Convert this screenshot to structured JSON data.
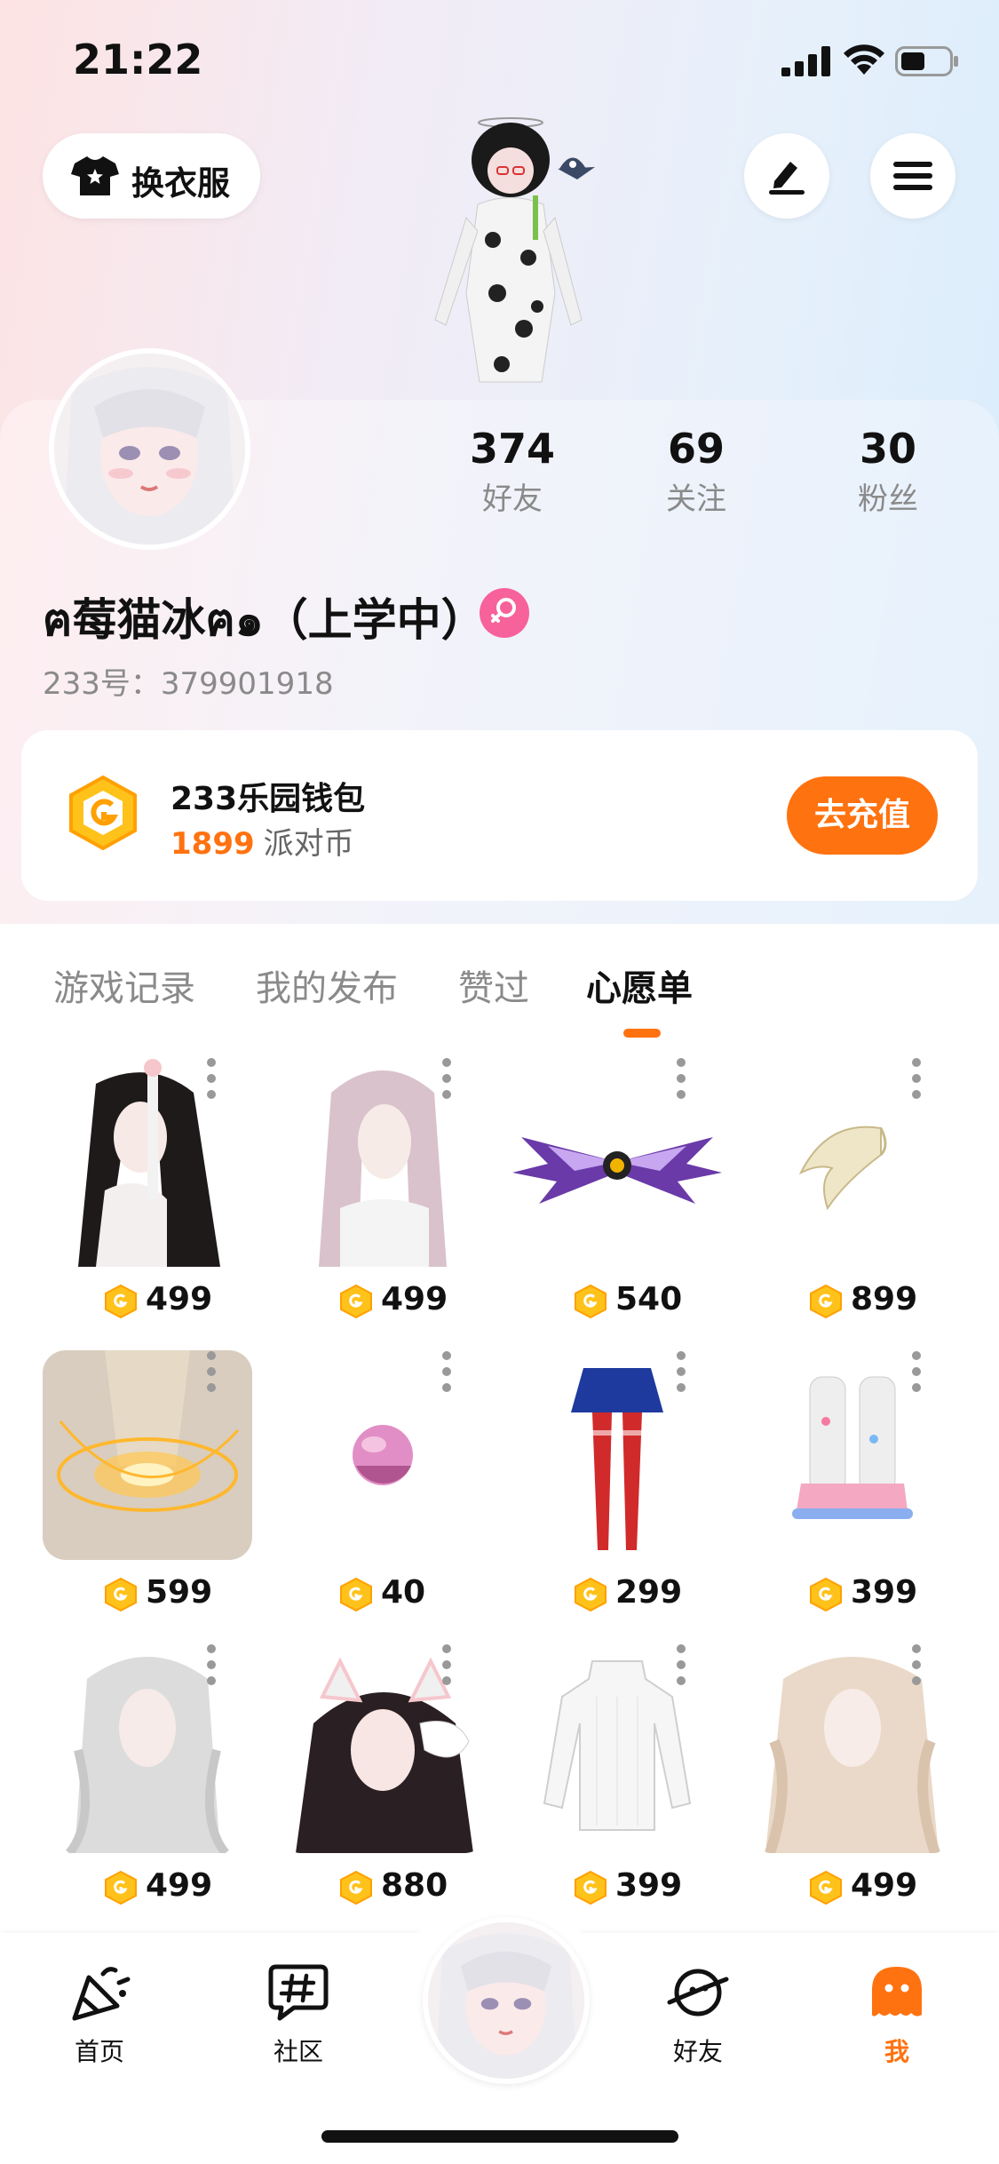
{
  "status": {
    "time": "21:22"
  },
  "header": {
    "dress_label": "换衣服",
    "edit_icon": "pen-icon",
    "menu_icon": "hamburger-icon"
  },
  "profile": {
    "stats": [
      {
        "value": "374",
        "label": "好友"
      },
      {
        "value": "69",
        "label": "关注"
      },
      {
        "value": "30",
        "label": "粉丝"
      }
    ],
    "username": "ฅ莓猫冰ฅ๑（上学中）",
    "gender": "female",
    "uid": "233号：379901918"
  },
  "wallet": {
    "title": "233乐园钱包",
    "amount": "1899",
    "unit": "派对币",
    "recharge_label": "去充值"
  },
  "tabs": [
    {
      "label": "游戏记录",
      "active": false
    },
    {
      "label": "我的发布",
      "active": false
    },
    {
      "label": "赞过",
      "active": false
    },
    {
      "label": "心愿单",
      "active": true
    }
  ],
  "wishlist": [
    {
      "price": "499",
      "kind": "long-dark-hair"
    },
    {
      "price": "499",
      "kind": "pink-hair"
    },
    {
      "price": "540",
      "kind": "purple-wings"
    },
    {
      "price": "899",
      "kind": "white-wings"
    },
    {
      "price": "599",
      "kind": "golden-halo-effect"
    },
    {
      "price": "40",
      "kind": "pink-ball"
    },
    {
      "price": "299",
      "kind": "skirt-stockings"
    },
    {
      "price": "399",
      "kind": "leg-warmer-shoes"
    },
    {
      "price": "499",
      "kind": "silver-hair"
    },
    {
      "price": "880",
      "kind": "cat-ear-hair"
    },
    {
      "price": "399",
      "kind": "white-sweater-dress"
    },
    {
      "price": "499",
      "kind": "blonde-wavy-hair"
    }
  ],
  "nav": [
    {
      "label": "首页",
      "icon": "party-popper-icon",
      "active": false
    },
    {
      "label": "社区",
      "icon": "hashtag-chat-icon",
      "active": false
    },
    {
      "label": "好友",
      "icon": "planet-icon",
      "active": false
    },
    {
      "label": "我",
      "icon": "ghost-icon",
      "active": true
    }
  ],
  "colors": {
    "accent": "#ff7210",
    "coin": "#ffb400",
    "gender": "#f7629a"
  }
}
